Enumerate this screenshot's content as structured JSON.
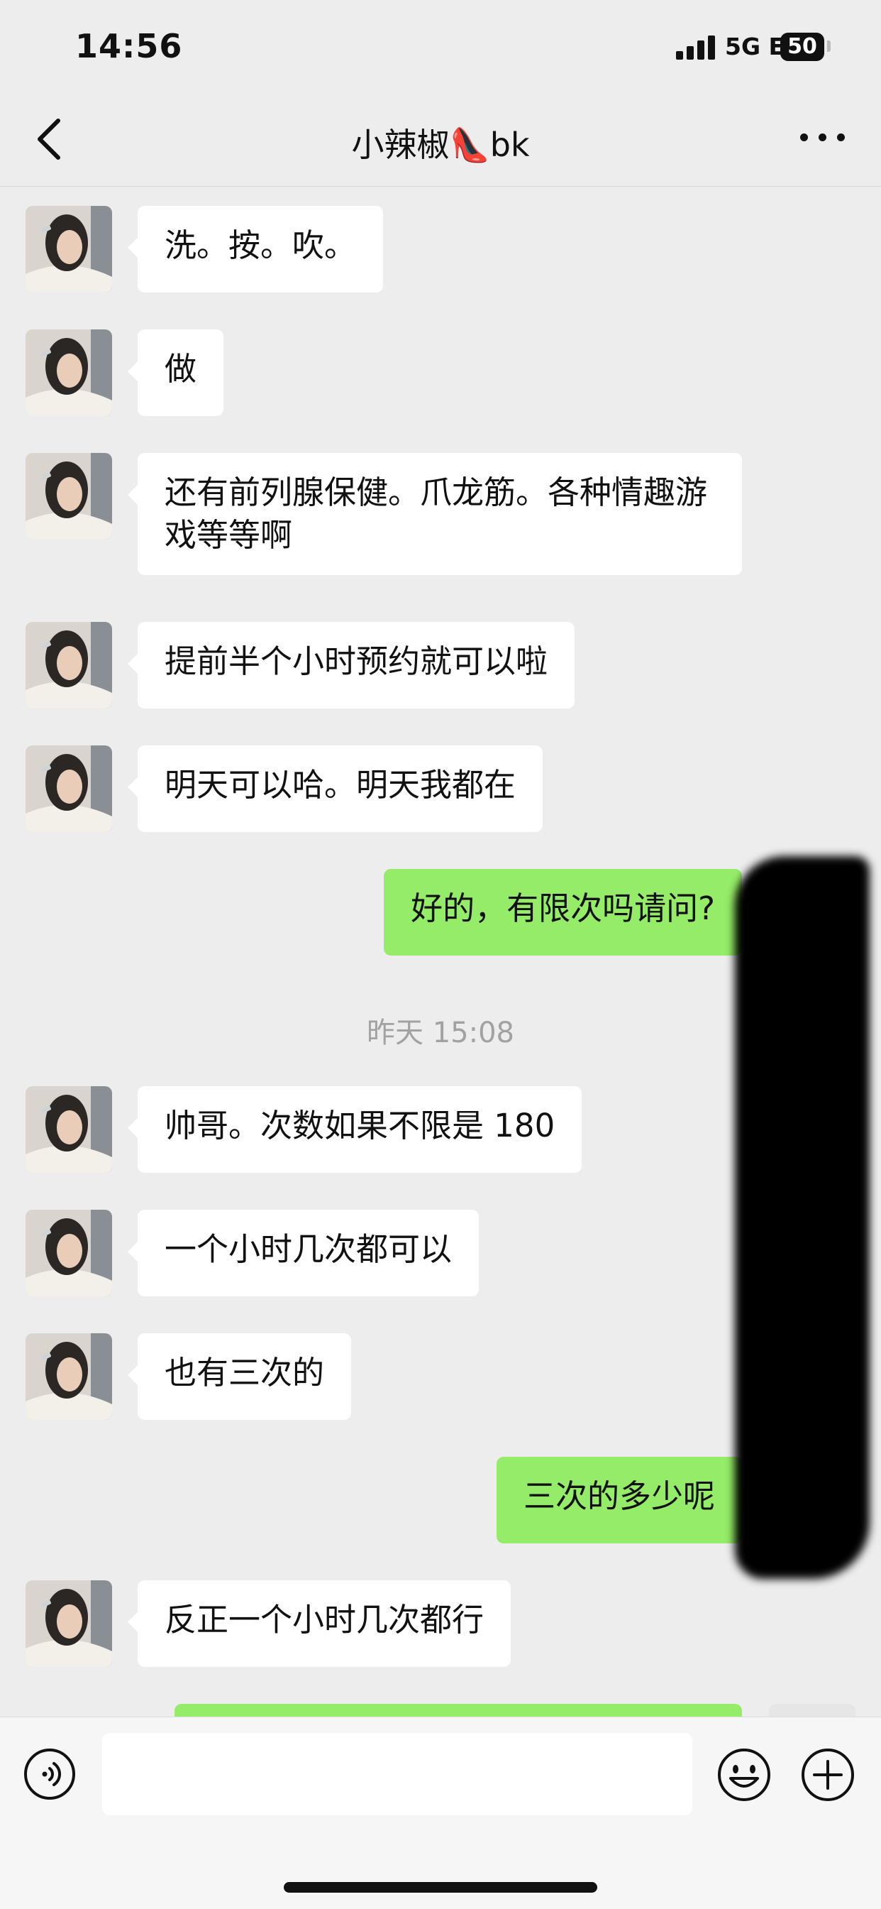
{
  "status_bar": {
    "time": "14:56",
    "network": "5G E",
    "battery": "50"
  },
  "nav": {
    "title": "小辣椒👠bk",
    "back_icon": "chevron-left-icon",
    "more_icon": "more-dots-icon"
  },
  "messages": [
    {
      "sender": "contact",
      "text": "洗。按。吹。"
    },
    {
      "sender": "contact",
      "text": "做"
    },
    {
      "sender": "contact",
      "text": "还有前列腺保健。爪龙筋。各种情趣游戏等等啊"
    },
    {
      "sender": "contact",
      "text": "提前半个小时预约就可以啦"
    },
    {
      "sender": "contact",
      "text": "明天可以哈。明天我都在"
    },
    {
      "sender": "me",
      "text": "好的，有限次吗请问?"
    },
    {
      "type": "timestamp",
      "text": "昨天 15:08"
    },
    {
      "sender": "contact",
      "text": "帅哥。次数如果不限是 180"
    },
    {
      "sender": "contact",
      "text": "一个小时几次都可以"
    },
    {
      "sender": "contact",
      "text": "也有三次的"
    },
    {
      "sender": "me",
      "text": "三次的多少呢"
    },
    {
      "sender": "contact",
      "text": "反正一个小时几次都行"
    }
  ],
  "input_bar": {
    "voice_icon": "voice-icon",
    "emoji_icon": "emoji-icon",
    "plus_icon": "plus-icon",
    "placeholder": ""
  },
  "colors": {
    "background": "#ededed",
    "incoming_bubble": "#ffffff",
    "outgoing_bubble": "#95ec69",
    "timestamp": "#a2a2a2"
  }
}
